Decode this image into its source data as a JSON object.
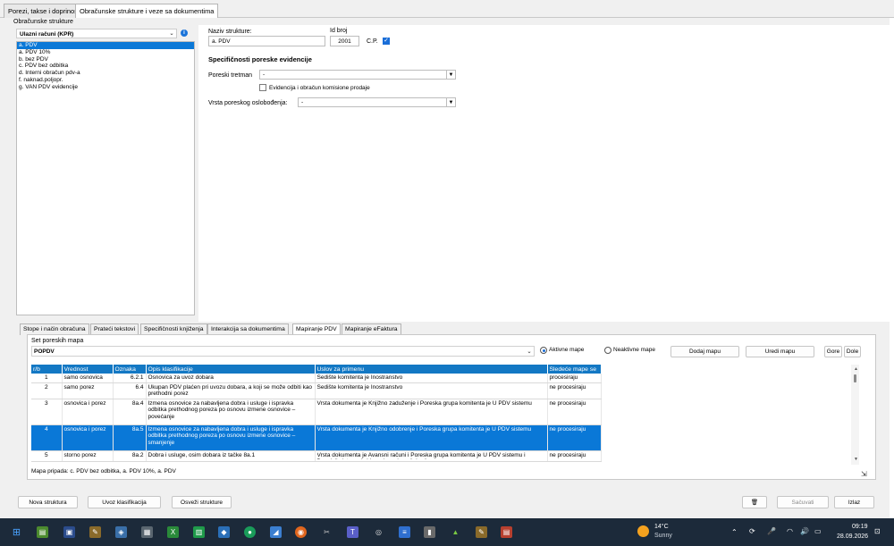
{
  "tabs": [
    {
      "label": "Porezi, takse i doprinosi"
    },
    {
      "label": "Obračunske strukture i veze sa dokumentima"
    }
  ],
  "left": {
    "group_label": "Obračunske strukture",
    "selector_value": "Ulazni računi (KPR)",
    "items": [
      {
        "label": "a. PDV"
      },
      {
        "label": "a. PDV 10%"
      },
      {
        "label": "b. bez PDV"
      },
      {
        "label": "c. PDV bez odbitka"
      },
      {
        "label": "d. Interni obračun pdv-a"
      },
      {
        "label": "f. naknad.poljopr."
      },
      {
        "label": "g. VAN PDV evidencije"
      }
    ]
  },
  "form": {
    "name_label": "Naziv strukture:",
    "name_value": "a. PDV",
    "id_label": "Id broj",
    "id_value": "2001",
    "cp_label": "C.P.",
    "section_title": "Specifičnosti poreske evidencije",
    "tax_label": "Poreski tretman",
    "tax_value": "-",
    "commission_label": "Evidencija i obračun komisione prodaje",
    "exempt_label": "Vrsta poreskog oslobođenja:",
    "exempt_value": "-"
  },
  "subtabs": [
    {
      "label": "Stope i način obračuna"
    },
    {
      "label": "Prateći tekstovi"
    },
    {
      "label": "Specifičnosti knjiženja"
    },
    {
      "label": "Interakcija sa dokumentima"
    },
    {
      "label": "Mapiranje PDV"
    },
    {
      "label": "Mapiranje eFaktura"
    }
  ],
  "mapping": {
    "set_label": "Set poreskih mapa",
    "set_value": "POPDV",
    "active_label": "Aktivne mape",
    "inactive_label": "Neaktivne mape",
    "add_label": "Dodaj mapu",
    "edit_label": "Uredi mapu",
    "up_label": "Gore",
    "down_label": "Dole",
    "columns": [
      "r/b",
      "Vrednost",
      "Oznaka",
      "Opis klasifikacije",
      "Uslov za primenu",
      "Sledeće mape se"
    ],
    "rows": [
      {
        "rb": "1",
        "vrednost": "samo osnovica",
        "oznaka": "6.2.1",
        "opis": "Osnovica za uvoz dobara",
        "uslov": "Sedište komitenta je Inostranstvo",
        "sledece": "procesiraju"
      },
      {
        "rb": "2",
        "vrednost": "samo porez",
        "oznaka": "6.4",
        "opis": "Ukupan PDV plaćen pri uvozu dobara, a koji se može odbiti kao prethodni porez",
        "uslov": "Sedište komitenta je Inostranstvo",
        "sledece": "ne procesiraju"
      },
      {
        "rb": "3",
        "vrednost": "osnovica i porez",
        "oznaka": "8a.4",
        "opis": "Izmena osnovice za nabavljena dobra i usluge i ispravka odbitka prethodnog poreza po osnovu izmene osnovice – povećanje",
        "uslov": "Vrsta dokumenta je Knjižno zaduženje i Poreska grupa komitenta je U PDV sistemu",
        "sledece": "ne procesiraju"
      },
      {
        "rb": "4",
        "vrednost": "osnovica i porez",
        "oznaka": "8a.5",
        "opis": "Izmena osnovice za nabavljena dobra i usluge i ispravka odbitka prethodnog poreza po osnovu izmene osnovice – smanjenje",
        "uslov": "Vrsta dokumenta je Knjižno odobrenje i Poreska grupa komitenta je U PDV sistemu",
        "sledece": "ne procesiraju"
      },
      {
        "rb": "5",
        "vrednost": "storno porez",
        "oznaka": "8a.2",
        "opis": "Dobra i usluge, osim dobara iz tačke 8a.1",
        "uslov": "Vrsta dokumenta je Avansni računi i Poreska grupa komitenta je U PDV sistemu i Dospjeli sistema je Vaganje za konačni račun",
        "sledece": "ne procesiraju"
      }
    ],
    "status_text": "Mapa pripada: c. PDV bez odbitka, a. PDV 10%, a. PDV"
  },
  "bottom": {
    "new_label": "Nova struktura",
    "import_label": "Uvoz klasifikacija",
    "refresh_label": "Osveži strukture",
    "save_label": "Sačuvati",
    "exit_label": "Izlaz"
  },
  "taskbar": {
    "temp": "14°C",
    "weather": "Sunny",
    "time": "09:19",
    "date": "28.09.2026"
  },
  "colors": {
    "accent": "#0a78d7",
    "header": "#1378c4",
    "taskbar": "#1c2a3a"
  }
}
